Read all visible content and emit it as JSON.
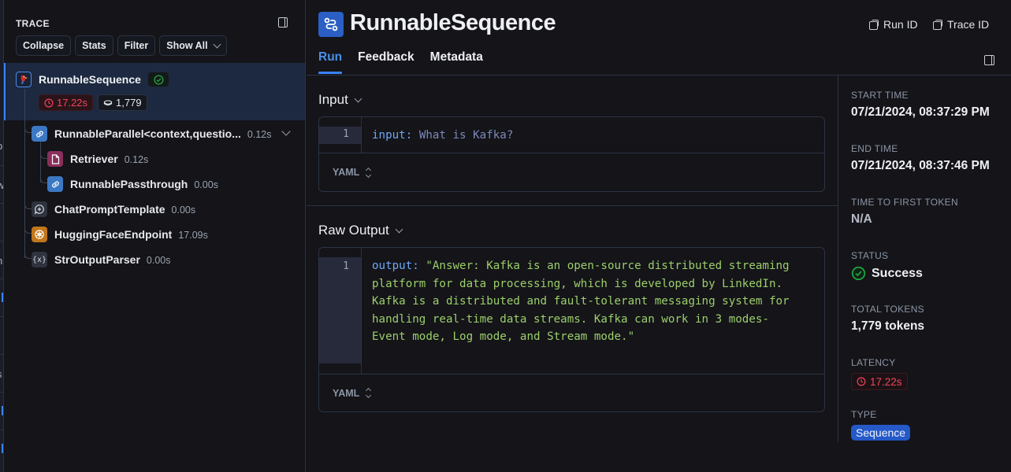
{
  "trace_panel": {
    "title": "TRACE",
    "toolbar": {
      "collapse_label": "Collapse",
      "stats_label": "Stats",
      "filter_label": "Filter",
      "show_all_label": "Show All"
    },
    "root": {
      "name": "RunnableSequence",
      "icon": "parrot-icon",
      "status": "success",
      "latency": "17.22s",
      "tokens": "1,779"
    },
    "children": [
      {
        "name": "RunnableParallel<context,questio...",
        "duration": "0.12s",
        "icon": "link-icon",
        "expanded": true,
        "children": [
          {
            "name": "Retriever",
            "duration": "0.12s",
            "icon": "document-icon"
          },
          {
            "name": "RunnablePassthrough",
            "duration": "0.00s",
            "icon": "link-icon"
          }
        ]
      },
      {
        "name": "ChatPromptTemplate",
        "duration": "0.00s",
        "icon": "chat-plus-icon"
      },
      {
        "name": "HuggingFaceEndpoint",
        "duration": "17.09s",
        "icon": "llm-icon"
      },
      {
        "name": "StrOutputParser",
        "duration": "0.00s",
        "icon": "variable-icon"
      }
    ]
  },
  "header": {
    "title": "RunnableSequence",
    "run_id_label": "Run ID",
    "trace_id_label": "Trace ID",
    "tabs": [
      {
        "label": "Run",
        "active": true
      },
      {
        "label": "Feedback",
        "active": false
      },
      {
        "label": "Metadata",
        "active": false
      }
    ]
  },
  "input_section": {
    "title": "Input",
    "line_number": "1",
    "key": "input",
    "value": "What is Kafka?",
    "format": "YAML"
  },
  "output_section": {
    "title": "Raw Output",
    "line_number": "1",
    "key": "output",
    "value": "\"Answer: Kafka is an open-source distributed streaming platform for data processing, which is developed by LinkedIn. Kafka is a distributed and fault-tolerant messaging system for handling real-time data streams. Kafka can work in 3 modes- Event mode, Log mode, and Stream mode.\"",
    "format": "YAML"
  },
  "meta": {
    "start_time_label": "START TIME",
    "start_time": "07/21/2024, 08:37:29 PM",
    "end_time_label": "END TIME",
    "end_time": "07/21/2024, 08:37:46 PM",
    "ttft_label": "TIME TO FIRST TOKEN",
    "ttft": "N/A",
    "status_label": "STATUS",
    "status": "Success",
    "total_tokens_label": "TOTAL TOKENS",
    "total_tokens": "1,779 tokens",
    "latency_label": "LATENCY",
    "latency": "17.22s",
    "type_label": "TYPE",
    "type": "Sequence"
  },
  "colors": {
    "accent": "#3b82f6",
    "success": "#22a745",
    "latency_red": "#f0455a",
    "yaml_string": "#9ccf6a",
    "yaml_key": "#6ea8f5"
  }
}
